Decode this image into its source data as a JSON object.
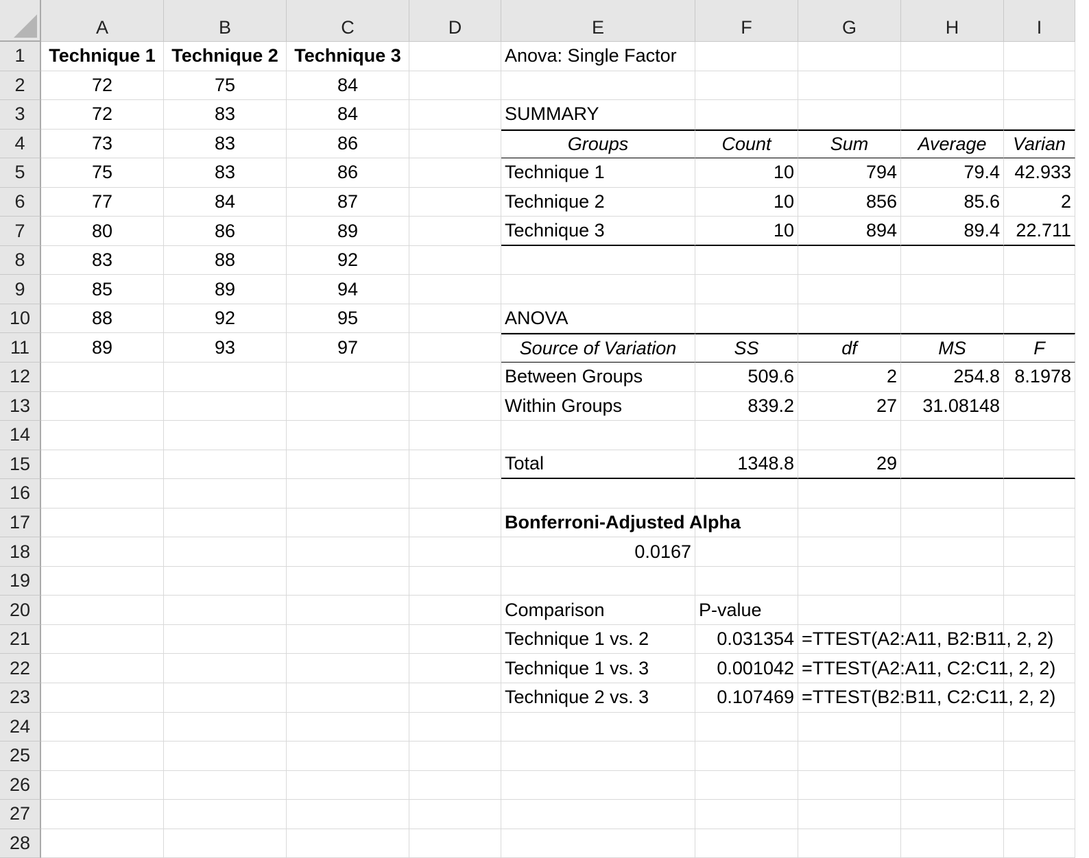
{
  "columns": [
    "A",
    "B",
    "C",
    "D",
    "E",
    "F",
    "G",
    "H",
    "I"
  ],
  "rows": [
    [
      "Technique 1",
      "Technique 2",
      "Technique 3",
      "",
      "Anova: Single Factor",
      "",
      "",
      "",
      ""
    ],
    [
      "72",
      "75",
      "84",
      "",
      "",
      "",
      "",
      "",
      ""
    ],
    [
      "72",
      "83",
      "84",
      "",
      "SUMMARY",
      "",
      "",
      "",
      ""
    ],
    [
      "73",
      "83",
      "86",
      "",
      "Groups",
      "Count",
      "Sum",
      "Average",
      "Varian"
    ],
    [
      "75",
      "83",
      "86",
      "",
      "Technique 1",
      "10",
      "794",
      "79.4",
      "42.933"
    ],
    [
      "77",
      "84",
      "87",
      "",
      "Technique 2",
      "10",
      "856",
      "85.6",
      "2"
    ],
    [
      "80",
      "86",
      "89",
      "",
      "Technique 3",
      "10",
      "894",
      "89.4",
      "22.711"
    ],
    [
      "83",
      "88",
      "92",
      "",
      "",
      "",
      "",
      "",
      ""
    ],
    [
      "85",
      "89",
      "94",
      "",
      "",
      "",
      "",
      "",
      ""
    ],
    [
      "88",
      "92",
      "95",
      "",
      "ANOVA",
      "",
      "",
      "",
      ""
    ],
    [
      "89",
      "93",
      "97",
      "",
      "Source of Variation",
      "SS",
      "df",
      "MS",
      "F"
    ],
    [
      "",
      "",
      "",
      "",
      "Between Groups",
      "509.6",
      "2",
      "254.8",
      "8.1978"
    ],
    [
      "",
      "",
      "",
      "",
      "Within Groups",
      "839.2",
      "27",
      "31.08148",
      ""
    ],
    [
      "",
      "",
      "",
      "",
      "",
      "",
      "",
      "",
      ""
    ],
    [
      "",
      "",
      "",
      "",
      "Total",
      "1348.8",
      "29",
      "",
      ""
    ],
    [
      "",
      "",
      "",
      "",
      "",
      "",
      "",
      "",
      ""
    ],
    [
      "",
      "",
      "",
      "",
      "Bonferroni-Adjusted Alpha",
      "",
      "",
      "",
      ""
    ],
    [
      "",
      "",
      "",
      "",
      "0.0167",
      "",
      "",
      "",
      ""
    ],
    [
      "",
      "",
      "",
      "",
      "",
      "",
      "",
      "",
      ""
    ],
    [
      "",
      "",
      "",
      "",
      "Comparison",
      "P-value",
      "",
      "",
      ""
    ],
    [
      "",
      "",
      "",
      "",
      "Technique 1 vs. 2",
      "0.031354",
      "=TTEST(A2:A11, B2:B11, 2, 2)",
      "",
      ""
    ],
    [
      "",
      "",
      "",
      "",
      "Technique 1 vs. 3",
      "0.001042",
      "=TTEST(A2:A11, C2:C11, 2, 2)",
      "",
      ""
    ],
    [
      "",
      "",
      "",
      "",
      "Technique 2 vs. 3",
      "0.107469",
      "=TTEST(B2:B11, C2:C11, 2, 2)",
      "",
      ""
    ],
    [
      "",
      "",
      "",
      "",
      "",
      "",
      "",
      "",
      ""
    ],
    [
      "",
      "",
      "",
      "",
      "",
      "",
      "",
      "",
      ""
    ],
    [
      "",
      "",
      "",
      "",
      "",
      "",
      "",
      "",
      ""
    ],
    [
      "",
      "",
      "",
      "",
      "",
      "",
      "",
      "",
      ""
    ],
    [
      "",
      "",
      "",
      "",
      "",
      "",
      "",
      "",
      ""
    ]
  ]
}
